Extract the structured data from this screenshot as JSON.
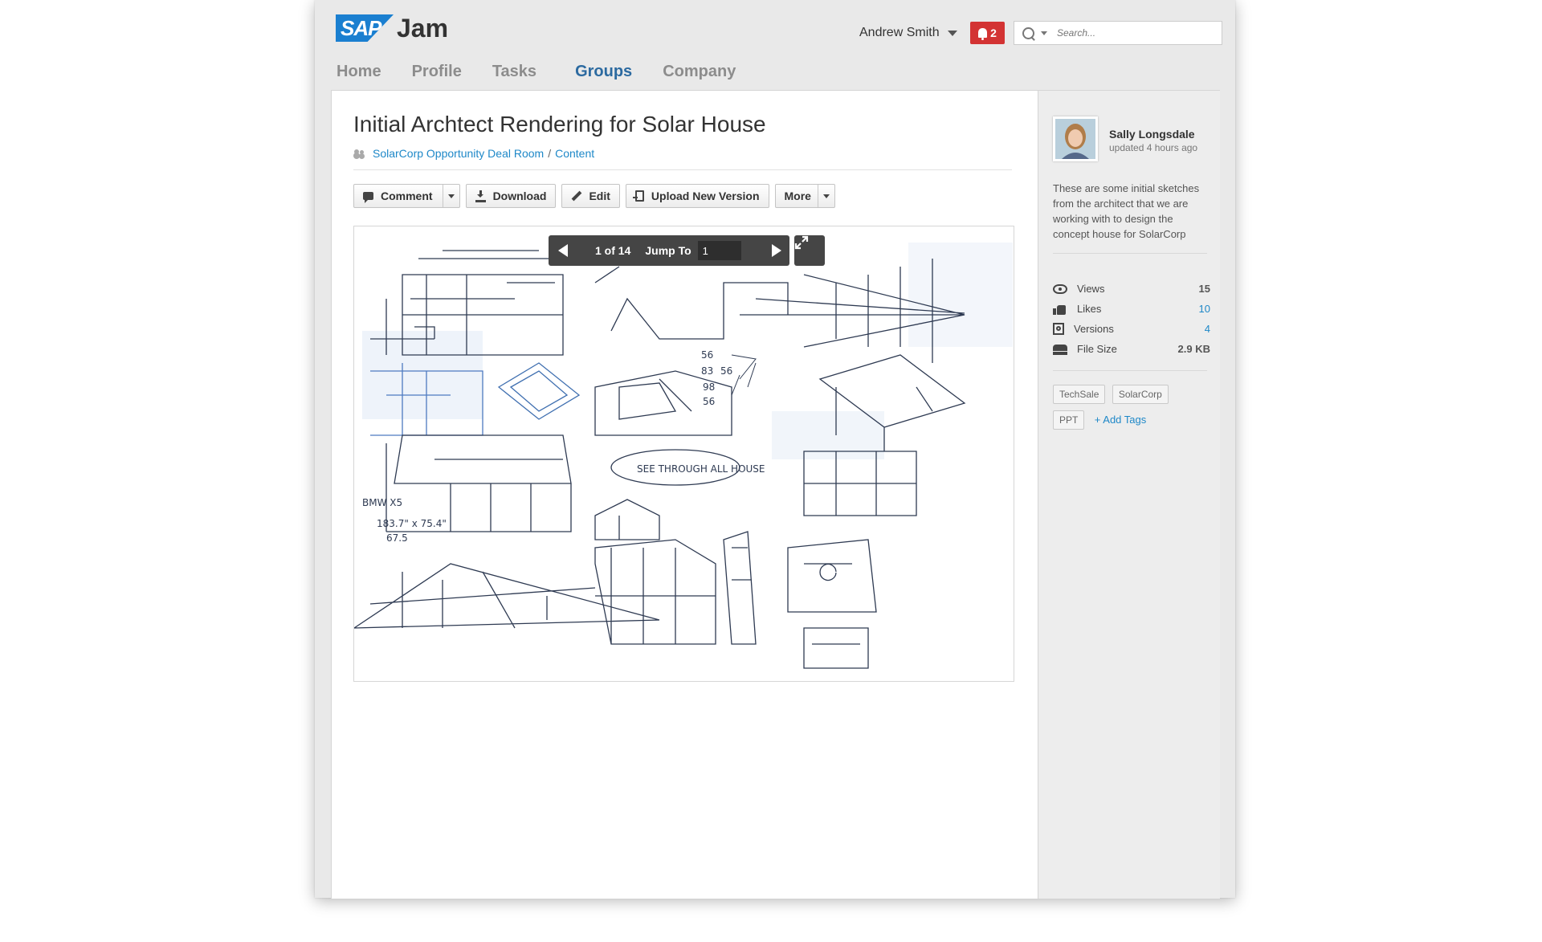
{
  "app": {
    "logo_badge": "SAP",
    "logo_text": "Jam",
    "accent_color": "#1a7fd0",
    "link_color": "#1e88c8"
  },
  "header": {
    "user_name": "Andrew Smith",
    "notification_count": "2",
    "search_placeholder": "Search..."
  },
  "nav": {
    "items": [
      "Home",
      "Profile",
      "Tasks",
      "Groups",
      "Company"
    ],
    "active": "Groups"
  },
  "document": {
    "title": "Initial Archtect Rendering for Solar House",
    "breadcrumb": [
      "SolarCorp Opportunity Deal Room",
      "Content"
    ],
    "breadcrumb_sep": "/"
  },
  "toolbar": {
    "comment": "Comment",
    "download": "Download",
    "edit": "Edit",
    "upload": "Upload New Version",
    "more": "More"
  },
  "viewer": {
    "page_indicator": "1 of 14",
    "jump_label": "Jump To",
    "jump_value": "1",
    "icons": [
      "prev-arrow-icon",
      "next-arrow-icon",
      "expand-icon"
    ],
    "sketch_notes": [
      "SEE THROUGH ALL HOUSE",
      "BMW X5",
      "183.7\" x 75.4\"",
      "67.5",
      "56",
      "83",
      "56",
      "98",
      "56"
    ]
  },
  "sidebar": {
    "author_name": "Sally Longsdale",
    "updated": "updated 4 hours ago",
    "description": "These are some initial sketches from the architect that we are working with to design the concept house for SolarCorp",
    "stats": [
      {
        "icon": "eye-icon",
        "label": "Views",
        "value": "15",
        "link": false
      },
      {
        "icon": "thumbs-up-icon",
        "label": "Likes",
        "value": "10",
        "link": true
      },
      {
        "icon": "versions-icon",
        "label": "Versions",
        "value": "4",
        "link": true
      },
      {
        "icon": "drive-icon",
        "label": "File Size",
        "value": "2.9 KB",
        "link": false
      }
    ],
    "tags": [
      "TechSale",
      "SolarCorp",
      "PPT"
    ],
    "add_tags": "+ Add Tags"
  }
}
